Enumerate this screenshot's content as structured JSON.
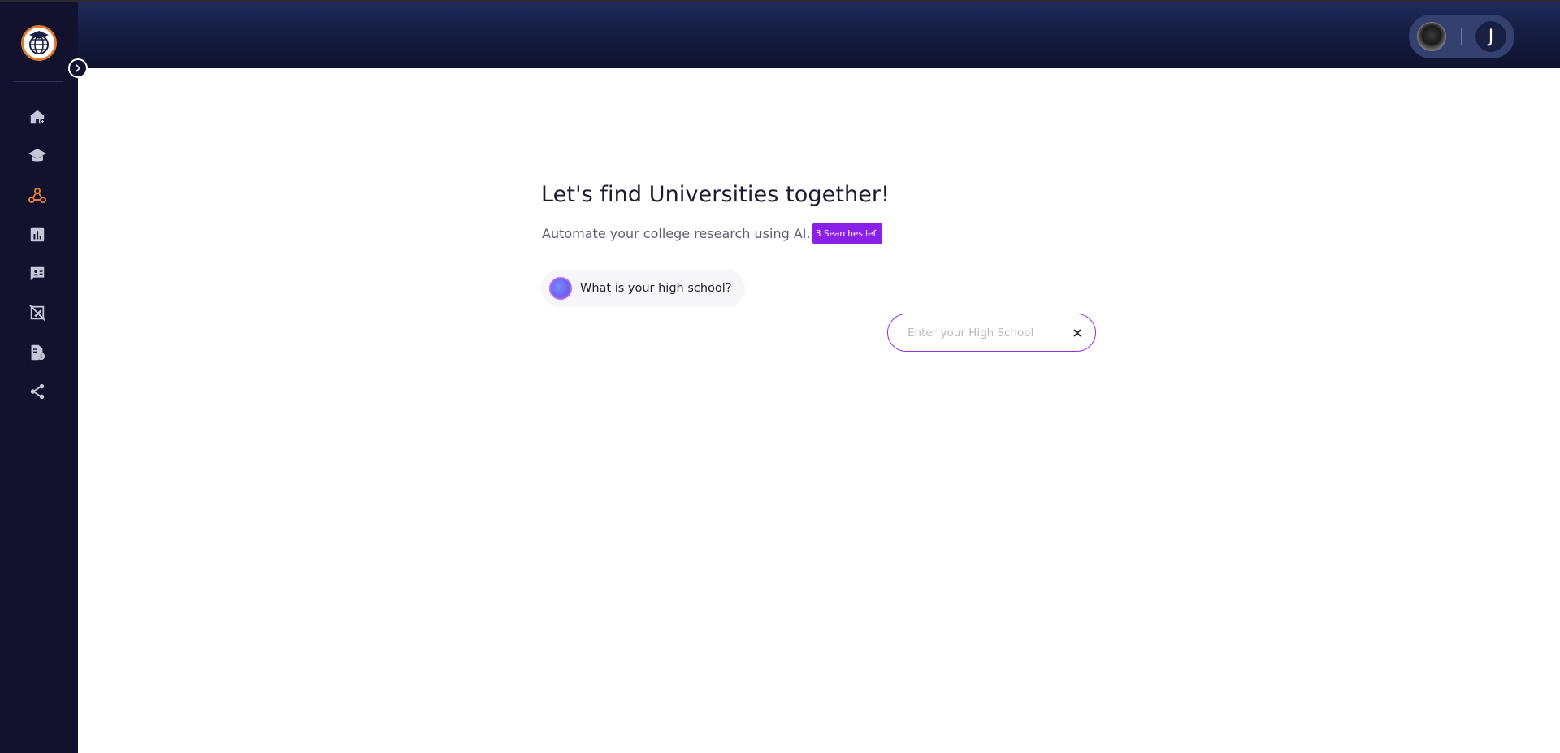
{
  "header": {
    "profile": {
      "avatar_initial": "J"
    }
  },
  "sidebar": {
    "items": [
      {
        "name": "home-icon",
        "active": false
      },
      {
        "name": "graduation-cap-icon",
        "active": false
      },
      {
        "name": "webhook-icon",
        "active": true
      },
      {
        "name": "bar-chart-icon",
        "active": false
      },
      {
        "name": "chat-person-icon",
        "active": false
      },
      {
        "name": "edit-off-icon",
        "active": false
      },
      {
        "name": "document-info-icon",
        "active": false
      },
      {
        "name": "share-icon",
        "active": false
      }
    ],
    "active_color": "#e07a2c",
    "icon_color": "#c5c7d8"
  },
  "main": {
    "title": "Let's find Universities together!",
    "subtitle": "Automate your college research using AI.",
    "badge": "3 Searches left",
    "question": "What is your high school?",
    "search": {
      "placeholder": "Enter your High School",
      "value": ""
    }
  },
  "colors": {
    "accent": "#8a1fe8",
    "header_bg": "#1f2a5a",
    "sidebar_bg": "#12112e"
  }
}
